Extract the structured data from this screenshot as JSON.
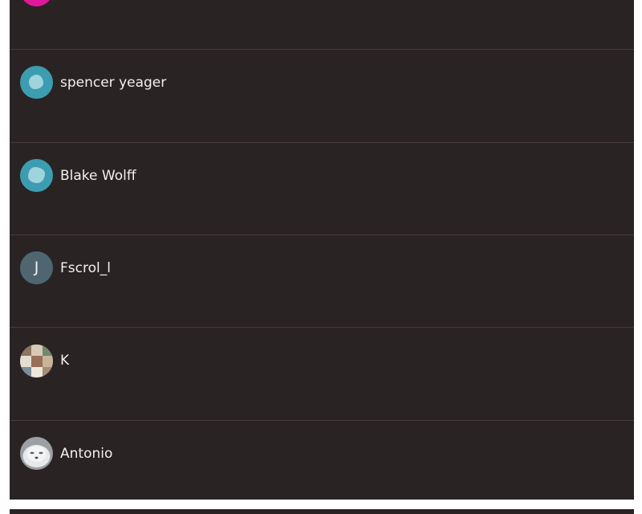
{
  "contacts": [
    {
      "name": "",
      "avatar": "pink-avatar-icon"
    },
    {
      "name": "spencer yeager",
      "avatar": "teal-blob-avatar-icon"
    },
    {
      "name": "Blake Wolff",
      "avatar": "teal-blob-avatar-icon"
    },
    {
      "name": "Fscrol_l",
      "avatar": "letter-avatar",
      "initial": "J"
    },
    {
      "name": "K",
      "avatar": "photo-collage-avatar"
    },
    {
      "name": "Antonio",
      "avatar": "seal-photo-avatar"
    }
  ],
  "colors": {
    "background": "#2a2324",
    "divider": "#47393b",
    "text": "#f4eef0",
    "teal": "#3d9db0",
    "pink": "#e0189a",
    "letter_avatar": "#4f6670"
  }
}
